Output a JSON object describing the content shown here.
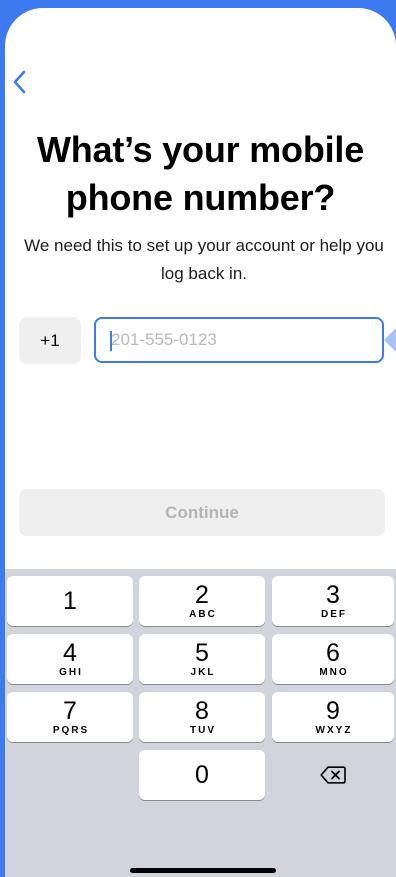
{
  "header": {
    "back_icon": "chevron-left-icon"
  },
  "title": "What’s your mobile phone number?",
  "subtitle": "We need this to set up your account or help you log back in.",
  "phone": {
    "country_code": "+1",
    "value": "",
    "placeholder": "201-555-0123"
  },
  "continue_label": "Continue",
  "keyboard": {
    "keys": [
      {
        "digit": "1",
        "letters": ""
      },
      {
        "digit": "2",
        "letters": "ABC"
      },
      {
        "digit": "3",
        "letters": "DEF"
      },
      {
        "digit": "4",
        "letters": "GHI"
      },
      {
        "digit": "5",
        "letters": "JKL"
      },
      {
        "digit": "6",
        "letters": "MNO"
      },
      {
        "digit": "7",
        "letters": "PQRS"
      },
      {
        "digit": "8",
        "letters": "TUV"
      },
      {
        "digit": "9",
        "letters": "WXYZ"
      },
      {
        "digit": "0",
        "letters": ""
      }
    ],
    "delete_icon": "backspace-icon"
  },
  "colors": {
    "accent": "#3d7af0",
    "button_disabled_bg": "#efeff0",
    "button_disabled_text": "#b4b4b8",
    "keyboard_bg": "#d1d4da"
  }
}
